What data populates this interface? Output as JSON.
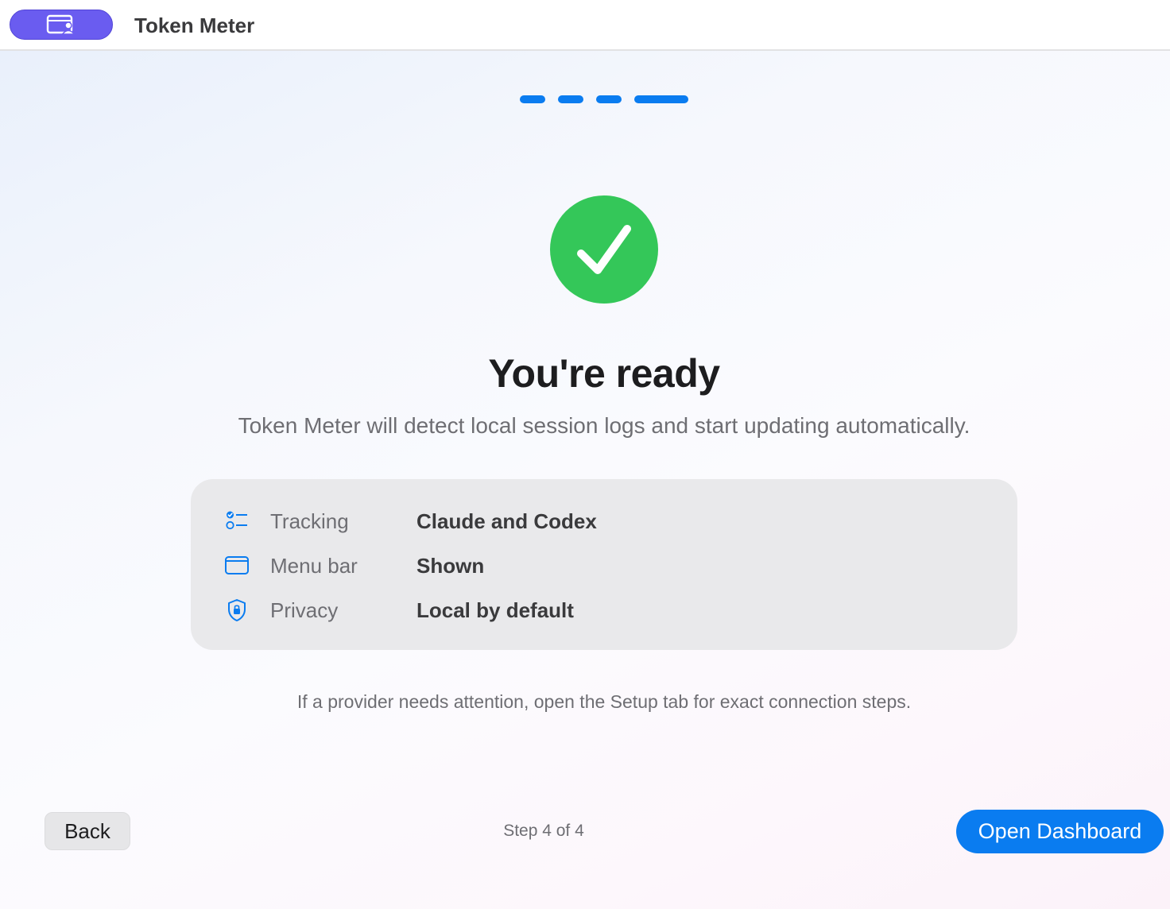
{
  "window": {
    "title": "Token Meter",
    "app_icon": "app-window-person-icon",
    "app_icon_color": "#6a5cf0"
  },
  "progress": {
    "total_steps": 4,
    "current_step": 4,
    "accent_color": "#0a7cf0"
  },
  "status": {
    "icon": "checkmark-circle-icon",
    "icon_color": "#34c759"
  },
  "heading": "You're ready",
  "subtitle": "Token Meter will detect local session logs and start updating automatically.",
  "summary": {
    "rows": [
      {
        "icon": "checklist-icon",
        "label": "Tracking",
        "value": "Claude and Codex"
      },
      {
        "icon": "window-icon",
        "label": "Menu bar",
        "value": "Shown"
      },
      {
        "icon": "lock-shield-icon",
        "label": "Privacy",
        "value": "Local by default"
      }
    ]
  },
  "hint": "If a provider needs attention, open the Setup tab for exact connection steps.",
  "footer": {
    "back_label": "Back",
    "step_text": "Step 4 of 4",
    "primary_label": "Open Dashboard"
  }
}
